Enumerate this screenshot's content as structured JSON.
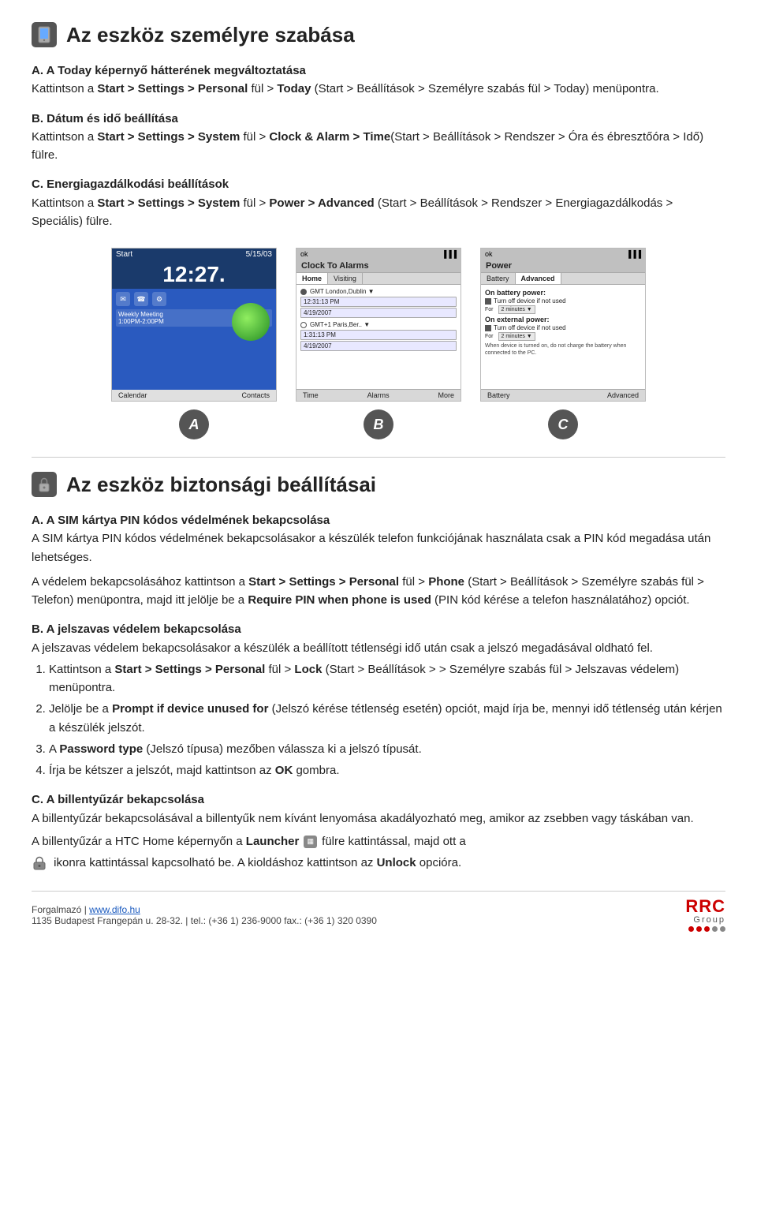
{
  "page": {
    "section1": {
      "title": "Az eszköz személyre szabása",
      "icon": "device-personalize-icon",
      "subsectionA": {
        "label": "A.",
        "title": "A Today képernyő hátterének megváltoztatása",
        "text": "Kattintson a ",
        "bold1": "Start > Settings > Personal",
        "text2": " fül > ",
        "bold2": "Today",
        "text3": " (Start > Beállítások > Személyre szabás fül > Today) menüpontra."
      },
      "subsectionB": {
        "label": "B.",
        "title": "Dátum és idő beállítása",
        "text": "Kattintson a ",
        "bold1": "Start > Settings > System",
        "text2": " fül > ",
        "bold2": "Clock & Alarm > Time",
        "text3": "(Start > Beállítások > Rendszer > Óra és ébresztőóra > Idő) fülre."
      },
      "subsectionC": {
        "label": "C.",
        "title": "Energiagazdálkodási beállítások",
        "text": "Kattintson a ",
        "bold1": "Start > Settings > System",
        "text2": " fül > ",
        "bold2": "Power > Advanced",
        "text3": " (Start > Beállítások > Rendszer > Energiagazdálkodás > Speciális) fülre."
      }
    },
    "screenshots": {
      "a": {
        "label": "A",
        "time": "12:27.",
        "date": "5/15/03",
        "meeting": "Weekly Meeting",
        "meeting_time": "1:00PM-2:00PM",
        "bottom_left": "Calendar",
        "bottom_right": "Contacts"
      },
      "b": {
        "label": "B",
        "title": "Clock To Alarms",
        "tab_home": "Home",
        "timezone": "GMT London,Dublin",
        "time1": "12:31:13 PM",
        "date1": "4/19/2007",
        "tab_visiting": "Visiting",
        "timezone2": "GMT+1 Paris,Berlin +",
        "time2": "1:31:13 PM",
        "date2": "4/19/2007",
        "tabs_bottom": [
          "Time",
          "Alarms",
          "More"
        ]
      },
      "c": {
        "label": "C",
        "title": "Power",
        "tab_battery": "Battery",
        "tab_advanced": "Advanced",
        "section_battery": "On battery power:",
        "check1": "Turn off device if not used",
        "dropdown1": "2 minutes",
        "for1": "For",
        "section_external": "On external power:",
        "check2": "Turn off device if not used",
        "dropdown2": "2 minutes",
        "for2": "For",
        "note": "When device is turned on, do not charge the battery when connected to the PC.",
        "tabs_bottom": [
          "Battery",
          "Advanced"
        ]
      }
    },
    "section2": {
      "title": "Az eszköz biztonsági beállításai",
      "icon": "lock-security-icon",
      "subsectionA": {
        "label": "A.",
        "title": "A SIM kártya PIN kódos védelmének bekapcsolása",
        "intro": "A SIM kártya PIN kódos védelmének bekapcsolásakor a készülék telefon funkciójának használata csak a PIN kód megadása után lehetséges.",
        "para": "A védelem bekapcsolásához kattintson a ",
        "bold1": "Start > Settings > Personal",
        "text2": " fül > ",
        "bold2": "Phone",
        "text3": " (Start > Beállítások > Személyre szabás fül > Telefon) menüpontra, majd itt jelölje be a ",
        "bold3": "Require PIN when phone is used",
        "text4": " (PIN kód kérése a telefon használatához) opciót."
      },
      "subsectionB": {
        "label": "B.",
        "title": "A jelszavas védelem bekapcsolása",
        "intro": "A jelszavas védelem bekapcsolásakor a készülék a beállított tétlenségi idő után csak a jelszó megadásával oldható fel.",
        "items": [
          {
            "num": "1.",
            "text": "Kattintson a ",
            "bold1": "Start > Settings > Personal",
            "text2": " fül > ",
            "bold2": "Lock",
            "text3": " (Start > Beállítások > > Személyre szabás fül > Jelszavas védelem) menüpontra."
          },
          {
            "num": "2.",
            "text": "Jelölje be a ",
            "bold1": "Prompt if device unused for",
            "text2": " (Jelszó kérése tétlenség esetén) opciót, majd írja be, mennyi idő tétlenség után kérjen a készülék jelszót."
          },
          {
            "num": "3.",
            "text": "A ",
            "bold1": "Password type",
            "text2": " (Jelszó típusa) mezőben válassza ki a jelszó típusát."
          },
          {
            "num": "4.",
            "text": "Írja be kétszer a jelszót, majd kattintson az ",
            "bold1": "OK",
            "text2": " gombra."
          }
        ]
      },
      "subsectionC": {
        "label": "C.",
        "title": "A billentyűzár bekapcsolása",
        "para1": "A billentyűzár bekapcsolásával a billentyűk nem kívánt lenyomása akadályozható meg, amikor az zsebben vagy táskában van.",
        "para2_start": "A billentyűzár a HTC Home képernyőn a ",
        "bold_launcher": "Launcher",
        "para2_end": " fülre kattintással, majd ott a",
        "para3": "ikonra kattintással kapcsolható be. A kioldáshoz kattintson az ",
        "bold_unlock": "Unlock",
        "para3_end": " opcióra."
      }
    },
    "footer": {
      "company": "Forgalmazó |",
      "website": "www.difo.hu",
      "address": "1135 Budapest Frangepán u. 28-32.",
      "tel": "tel.: (+36 1) 236-9000",
      "fax": "fax.: (+36 1) 320 0390",
      "logo_rrc": "RRC",
      "logo_group": "Group"
    }
  }
}
